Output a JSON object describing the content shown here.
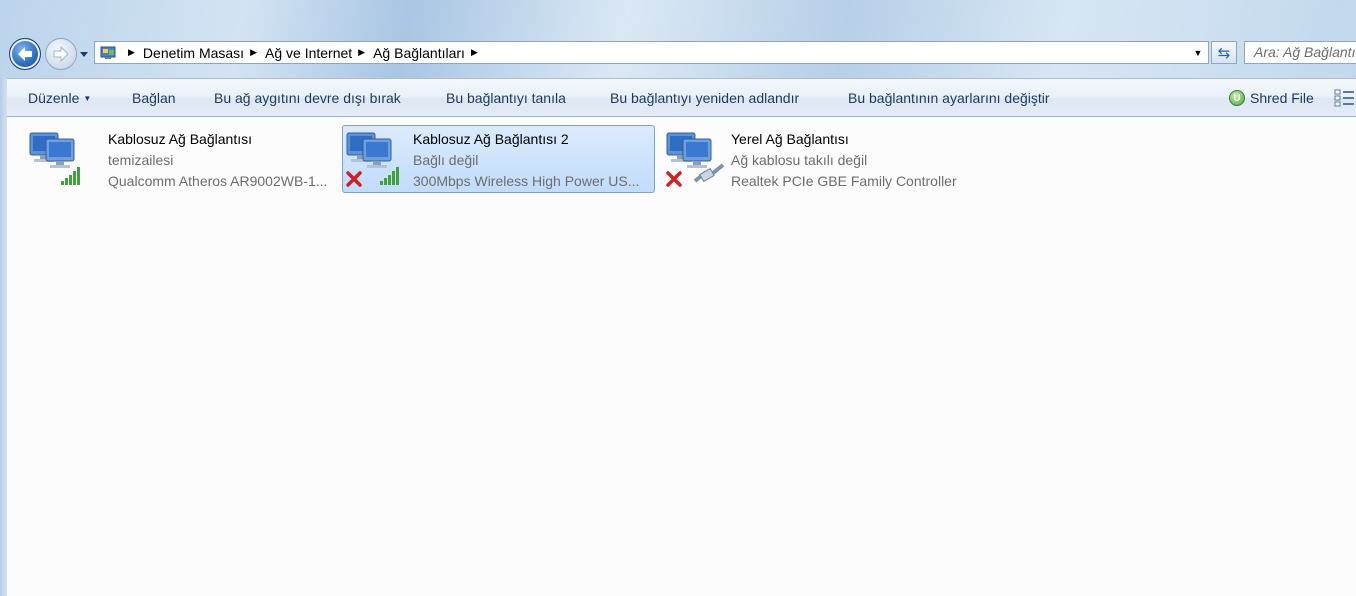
{
  "window": {
    "ghost_title": "Kablosuz Ağ Bağlantısı 2"
  },
  "address_bar": {
    "breadcrumbs": [
      "Denetim Masası",
      "Ağ ve Internet",
      "Ağ Bağlantıları"
    ]
  },
  "search": {
    "placeholder": "Ara: Ağ Bağlantıları"
  },
  "toolbar": {
    "organize": "Düzenle",
    "connect": "Bağlan",
    "disable": "Bu ağ aygıtını devre dışı bırak",
    "diagnose": "Bu bağlantıyı tanıla",
    "rename": "Bu bağlantıyı yeniden adlandır",
    "change_settings": "Bu bağlantının ayarlarını değiştir",
    "shred_file": "Shred File"
  },
  "connections": [
    {
      "name": "Kablosuz Ağ Bağlantısı",
      "status": "temizailesi",
      "device": "Qualcomm Atheros AR9002WB-1...",
      "icon": "wireless-network-icon",
      "disconnected": false,
      "selected": false
    },
    {
      "name": "Kablosuz Ağ Bağlantısı 2",
      "status": "Bağlı değil",
      "device": "300Mbps Wireless High Power US...",
      "icon": "wireless-network-icon",
      "disconnected": true,
      "selected": true
    },
    {
      "name": "Yerel Ağ Bağlantısı",
      "status": "Ağ kablosu takılı değil",
      "device": "Realtek PCIe GBE Family Controller",
      "icon": "ethernet-network-icon",
      "disconnected": true,
      "selected": false
    }
  ],
  "colors": {
    "command_text": "#1e395b",
    "selection": "#c1dcfc",
    "disconnect_x": "#d21f1f",
    "signal_green": "#3fa33a"
  }
}
